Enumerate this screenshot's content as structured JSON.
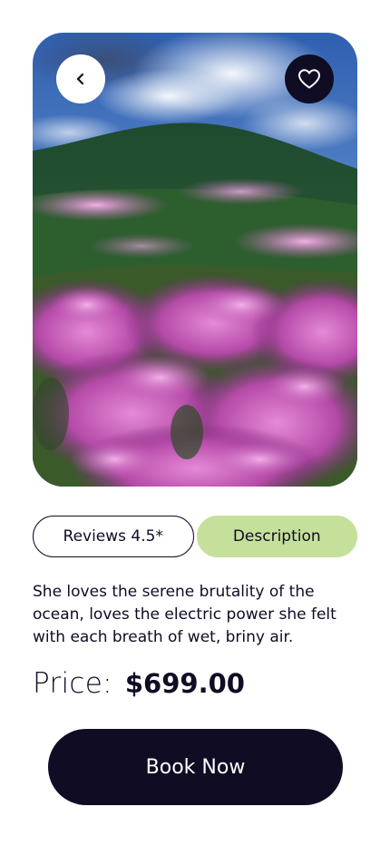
{
  "hero": {
    "image_name": "pink-blossom-mountain-landscape",
    "back_icon": "chevron-left-icon",
    "favorite_icon": "heart-icon"
  },
  "tabs": [
    {
      "label": "Reviews 4.5*",
      "active": false
    },
    {
      "label": "Description",
      "active": true
    }
  ],
  "description": "She loves the serene brutality of the ocean, loves the electric power she felt with each breath of wet, briny air.",
  "price": {
    "label": "Price:",
    "value": "$699.00"
  },
  "cta": {
    "label": "Book Now"
  },
  "colors": {
    "primary_dark": "#0f0c24",
    "active_tab": "#c5e09a",
    "background": "#ffffff"
  }
}
